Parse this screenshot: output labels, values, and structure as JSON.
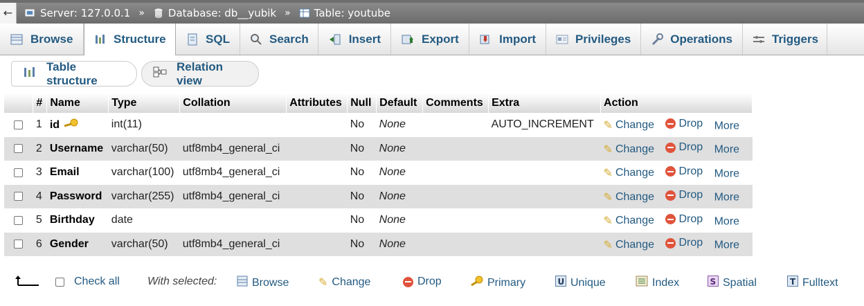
{
  "breadcrumb": {
    "back_glyph": "←",
    "server": "Server: 127.0.0.1",
    "database": "Database: db__yubik",
    "table": "Table: youtube",
    "separator": "»"
  },
  "tabs": [
    {
      "label": "Browse",
      "icon": "browse-icon",
      "active": false
    },
    {
      "label": "Structure",
      "icon": "structure-icon",
      "active": true
    },
    {
      "label": "SQL",
      "icon": "sql-icon",
      "active": false
    },
    {
      "label": "Search",
      "icon": "search-icon",
      "active": false
    },
    {
      "label": "Insert",
      "icon": "insert-icon",
      "active": false
    },
    {
      "label": "Export",
      "icon": "export-icon",
      "active": false
    },
    {
      "label": "Import",
      "icon": "import-icon",
      "active": false
    },
    {
      "label": "Privileges",
      "icon": "privileges-icon",
      "active": false
    },
    {
      "label": "Operations",
      "icon": "wrench-icon",
      "active": false
    },
    {
      "label": "Triggers",
      "icon": "triggers-icon",
      "active": false
    }
  ],
  "subtabs": {
    "table_structure": "Table structure",
    "relation_view": "Relation view"
  },
  "columns": [
    "#",
    "Name",
    "Type",
    "Collation",
    "Attributes",
    "Null",
    "Default",
    "Comments",
    "Extra",
    "Action"
  ],
  "rows": [
    {
      "num": "1",
      "name": "id",
      "primary": true,
      "type": "int(11)",
      "collation": "",
      "attributes": "",
      "null": "No",
      "default": "None",
      "comments": "",
      "extra": "AUTO_INCREMENT"
    },
    {
      "num": "2",
      "name": "Username",
      "primary": false,
      "type": "varchar(50)",
      "collation": "utf8mb4_general_ci",
      "attributes": "",
      "null": "No",
      "default": "None",
      "comments": "",
      "extra": ""
    },
    {
      "num": "3",
      "name": "Email",
      "primary": false,
      "type": "varchar(100)",
      "collation": "utf8mb4_general_ci",
      "attributes": "",
      "null": "No",
      "default": "None",
      "comments": "",
      "extra": ""
    },
    {
      "num": "4",
      "name": "Password",
      "primary": false,
      "type": "varchar(255)",
      "collation": "utf8mb4_general_ci",
      "attributes": "",
      "null": "No",
      "default": "None",
      "comments": "",
      "extra": ""
    },
    {
      "num": "5",
      "name": "Birthday",
      "primary": false,
      "type": "date",
      "collation": "",
      "attributes": "",
      "null": "No",
      "default": "None",
      "comments": "",
      "extra": ""
    },
    {
      "num": "6",
      "name": "Gender",
      "primary": false,
      "type": "varchar(50)",
      "collation": "utf8mb4_general_ci",
      "attributes": "",
      "null": "No",
      "default": "None",
      "comments": "",
      "extra": ""
    }
  ],
  "row_actions": {
    "change": "Change",
    "drop": "Drop",
    "more": "More"
  },
  "footer": {
    "check_all": "Check all",
    "with_selected": "With selected:",
    "browse": "Browse",
    "change": "Change",
    "drop": "Drop",
    "primary": "Primary",
    "unique": "Unique",
    "index": "Index",
    "spatial": "Spatial",
    "fulltext": "Fulltext"
  },
  "colors": {
    "link": "#235a81",
    "drop": "#e0533b",
    "pencil": "#d6a92b",
    "row_alt": "#dfdfdf"
  }
}
